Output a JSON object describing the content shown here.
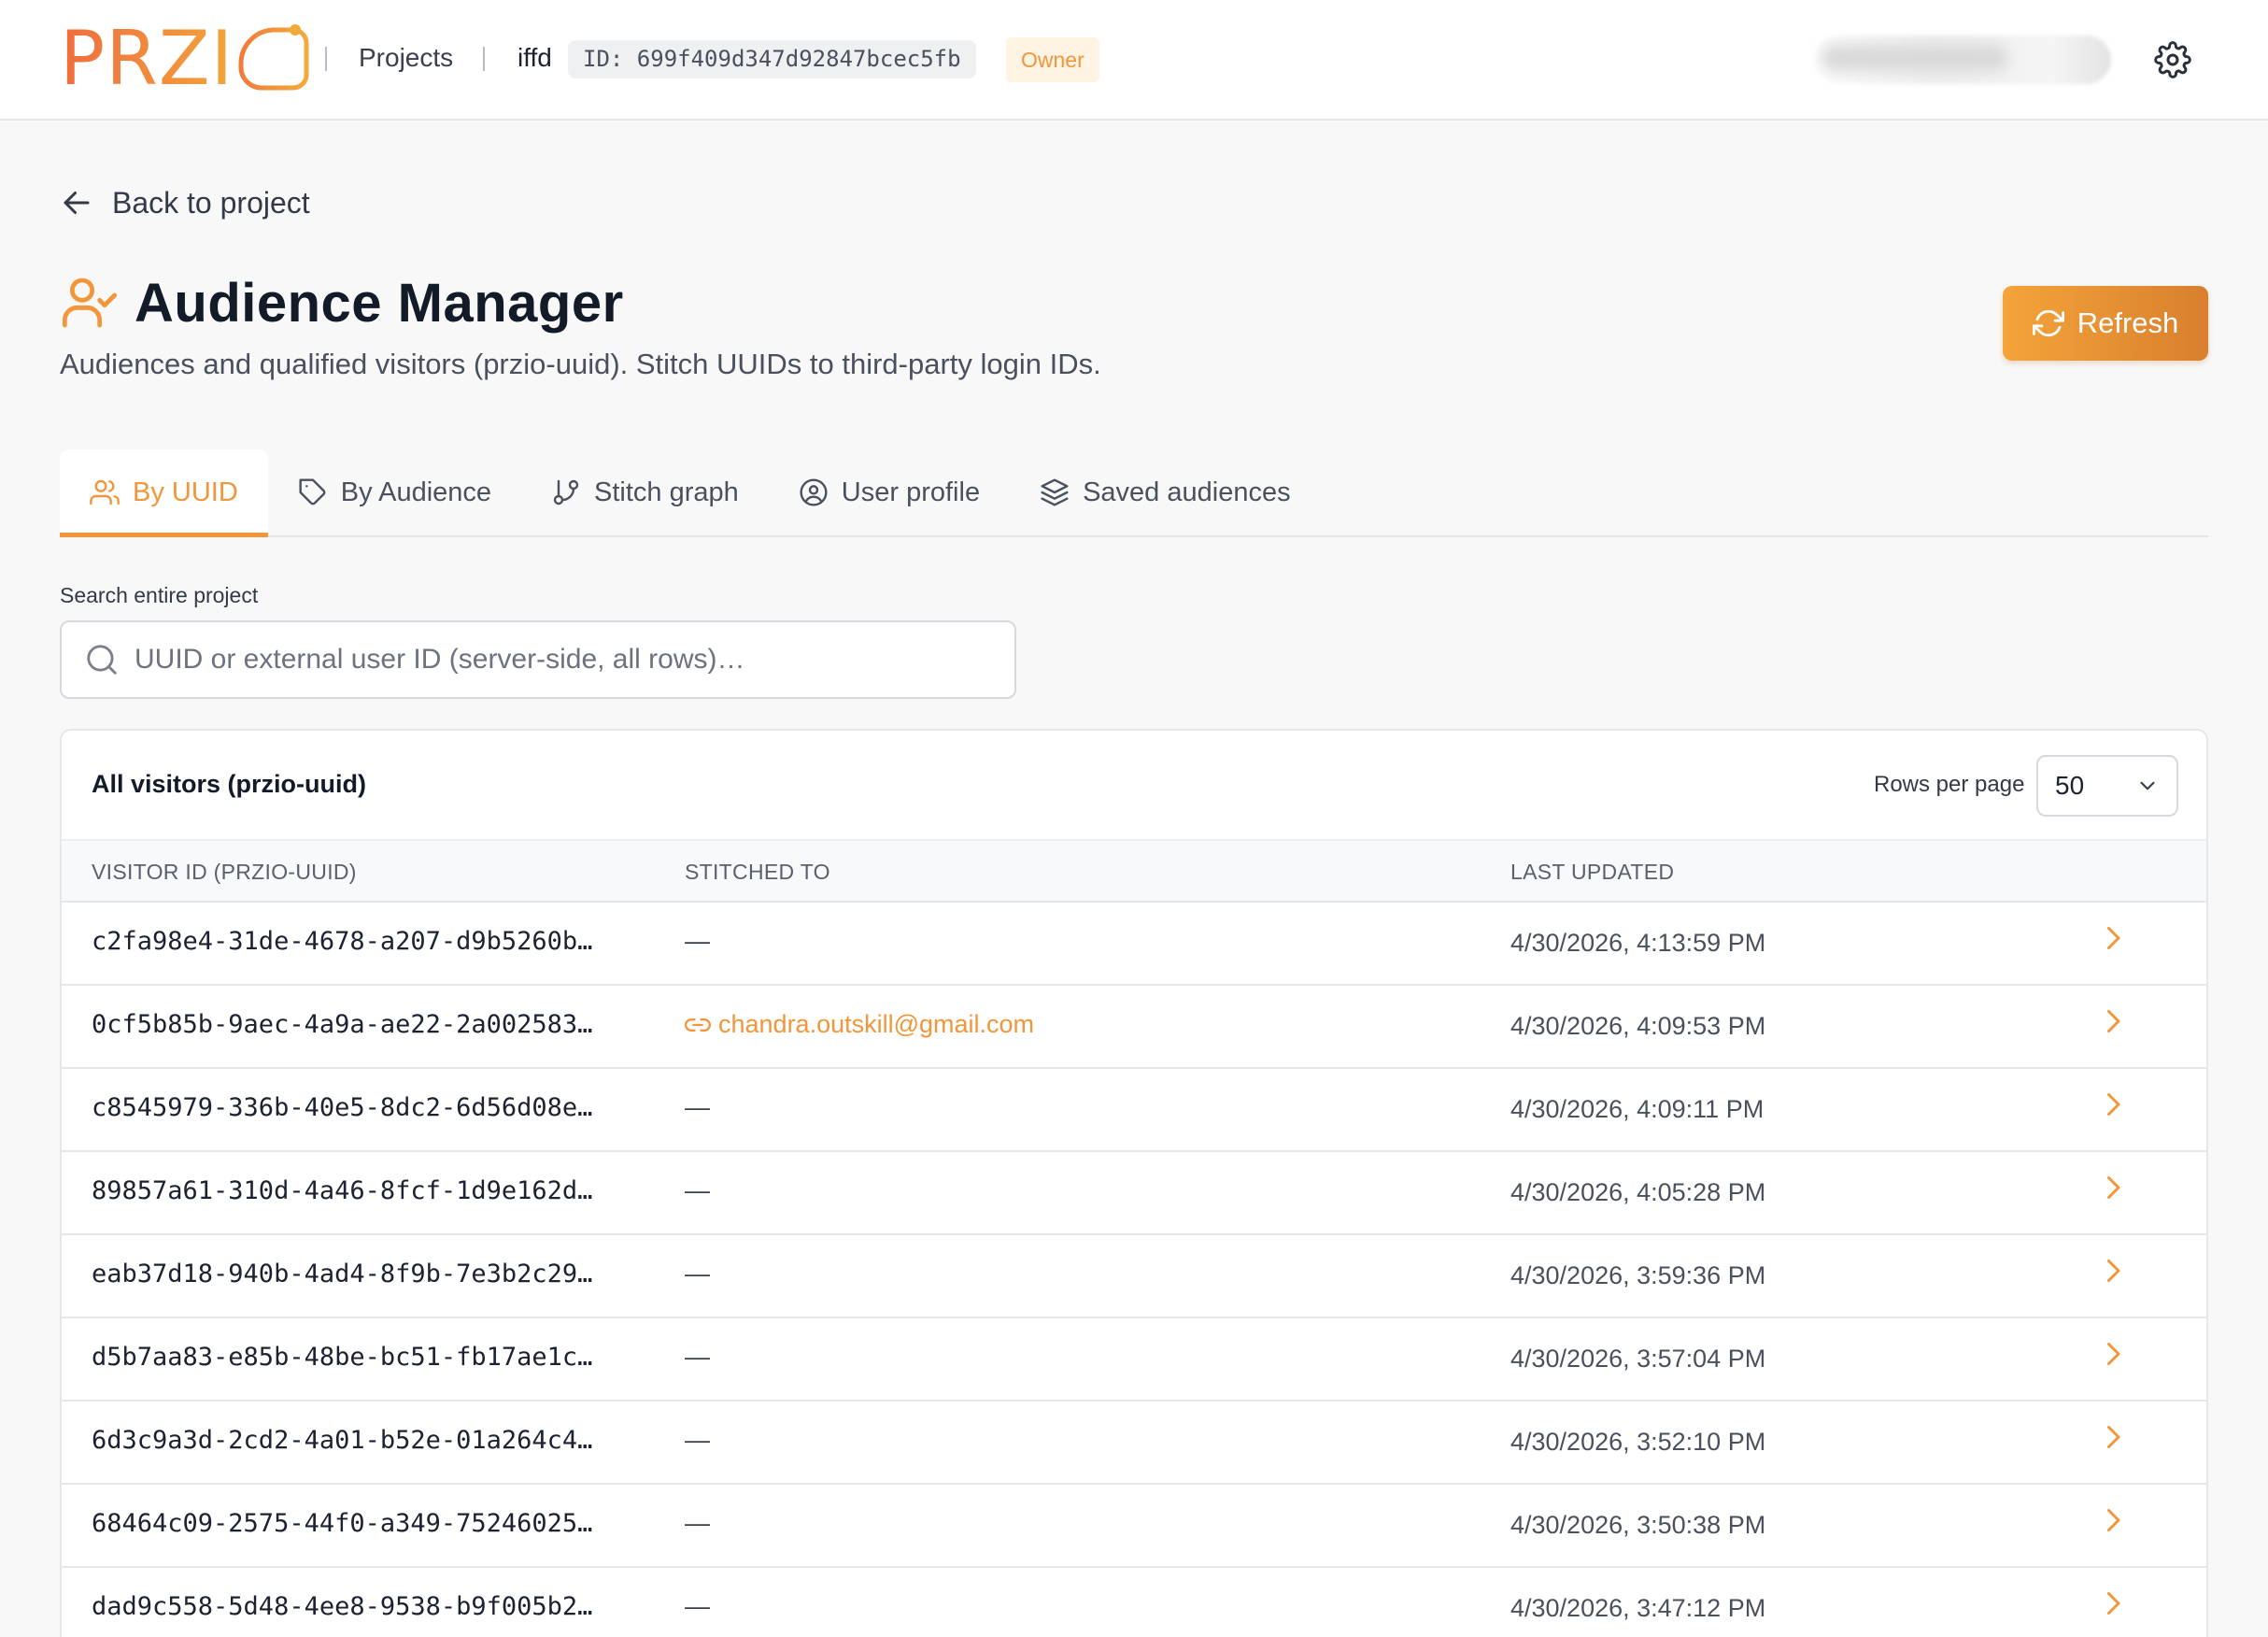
{
  "header": {
    "logo_text": "PRZI",
    "crumbs": {
      "projects": "Projects",
      "project": "iffd"
    },
    "project_id": "ID: 699f409d347d92847bcec5fb",
    "role_badge": "Owner",
    "accent_color": "#f1963a"
  },
  "nav": {
    "back_label": "Back to project"
  },
  "page": {
    "title": "Audience Manager",
    "subtitle": "Audiences and qualified visitors (przio-uuid). Stitch UUIDs to third-party login IDs.",
    "refresh_label": "Refresh"
  },
  "tabs": [
    {
      "label": "By UUID",
      "icon": "users-icon",
      "active": true
    },
    {
      "label": "By Audience",
      "icon": "tag-icon",
      "active": false
    },
    {
      "label": "Stitch graph",
      "icon": "git-branch-icon",
      "active": false
    },
    {
      "label": "User profile",
      "icon": "user-circle-icon",
      "active": false
    },
    {
      "label": "Saved audiences",
      "icon": "layers-icon",
      "active": false
    }
  ],
  "search": {
    "label": "Search entire project",
    "placeholder": "UUID or external user ID (server-side, all rows)…",
    "value": ""
  },
  "table": {
    "title": "All visitors (przio-uuid)",
    "rows_per_page_label": "Rows per page",
    "rows_per_page_value": "50",
    "columns": [
      "VISITOR ID (PRZIO-UUID)",
      "STITCHED TO",
      "LAST UPDATED"
    ],
    "rows": [
      {
        "uuid": "c2fa98e4-31de-4678-a207-d9b5260b…",
        "stitched": "—",
        "linked": false,
        "updated": "4/30/2026, 4:13:59 PM"
      },
      {
        "uuid": "0cf5b85b-9aec-4a9a-ae22-2a002583…",
        "stitched": "chandra.outskill@gmail.com",
        "linked": true,
        "updated": "4/30/2026, 4:09:53 PM"
      },
      {
        "uuid": "c8545979-336b-40e5-8dc2-6d56d08e…",
        "stitched": "—",
        "linked": false,
        "updated": "4/30/2026, 4:09:11 PM"
      },
      {
        "uuid": "89857a61-310d-4a46-8fcf-1d9e162d…",
        "stitched": "—",
        "linked": false,
        "updated": "4/30/2026, 4:05:28 PM"
      },
      {
        "uuid": "eab37d18-940b-4ad4-8f9b-7e3b2c29…",
        "stitched": "—",
        "linked": false,
        "updated": "4/30/2026, 3:59:36 PM"
      },
      {
        "uuid": "d5b7aa83-e85b-48be-bc51-fb17ae1c…",
        "stitched": "—",
        "linked": false,
        "updated": "4/30/2026, 3:57:04 PM"
      },
      {
        "uuid": "6d3c9a3d-2cd2-4a01-b52e-01a264c4…",
        "stitched": "—",
        "linked": false,
        "updated": "4/30/2026, 3:52:10 PM"
      },
      {
        "uuid": "68464c09-2575-44f0-a349-75246025…",
        "stitched": "—",
        "linked": false,
        "updated": "4/30/2026, 3:50:38 PM"
      },
      {
        "uuid": "dad9c558-5d48-4ee8-9538-b9f005b2…",
        "stitched": "—",
        "linked": false,
        "updated": "4/30/2026, 3:47:12 PM"
      }
    ]
  }
}
